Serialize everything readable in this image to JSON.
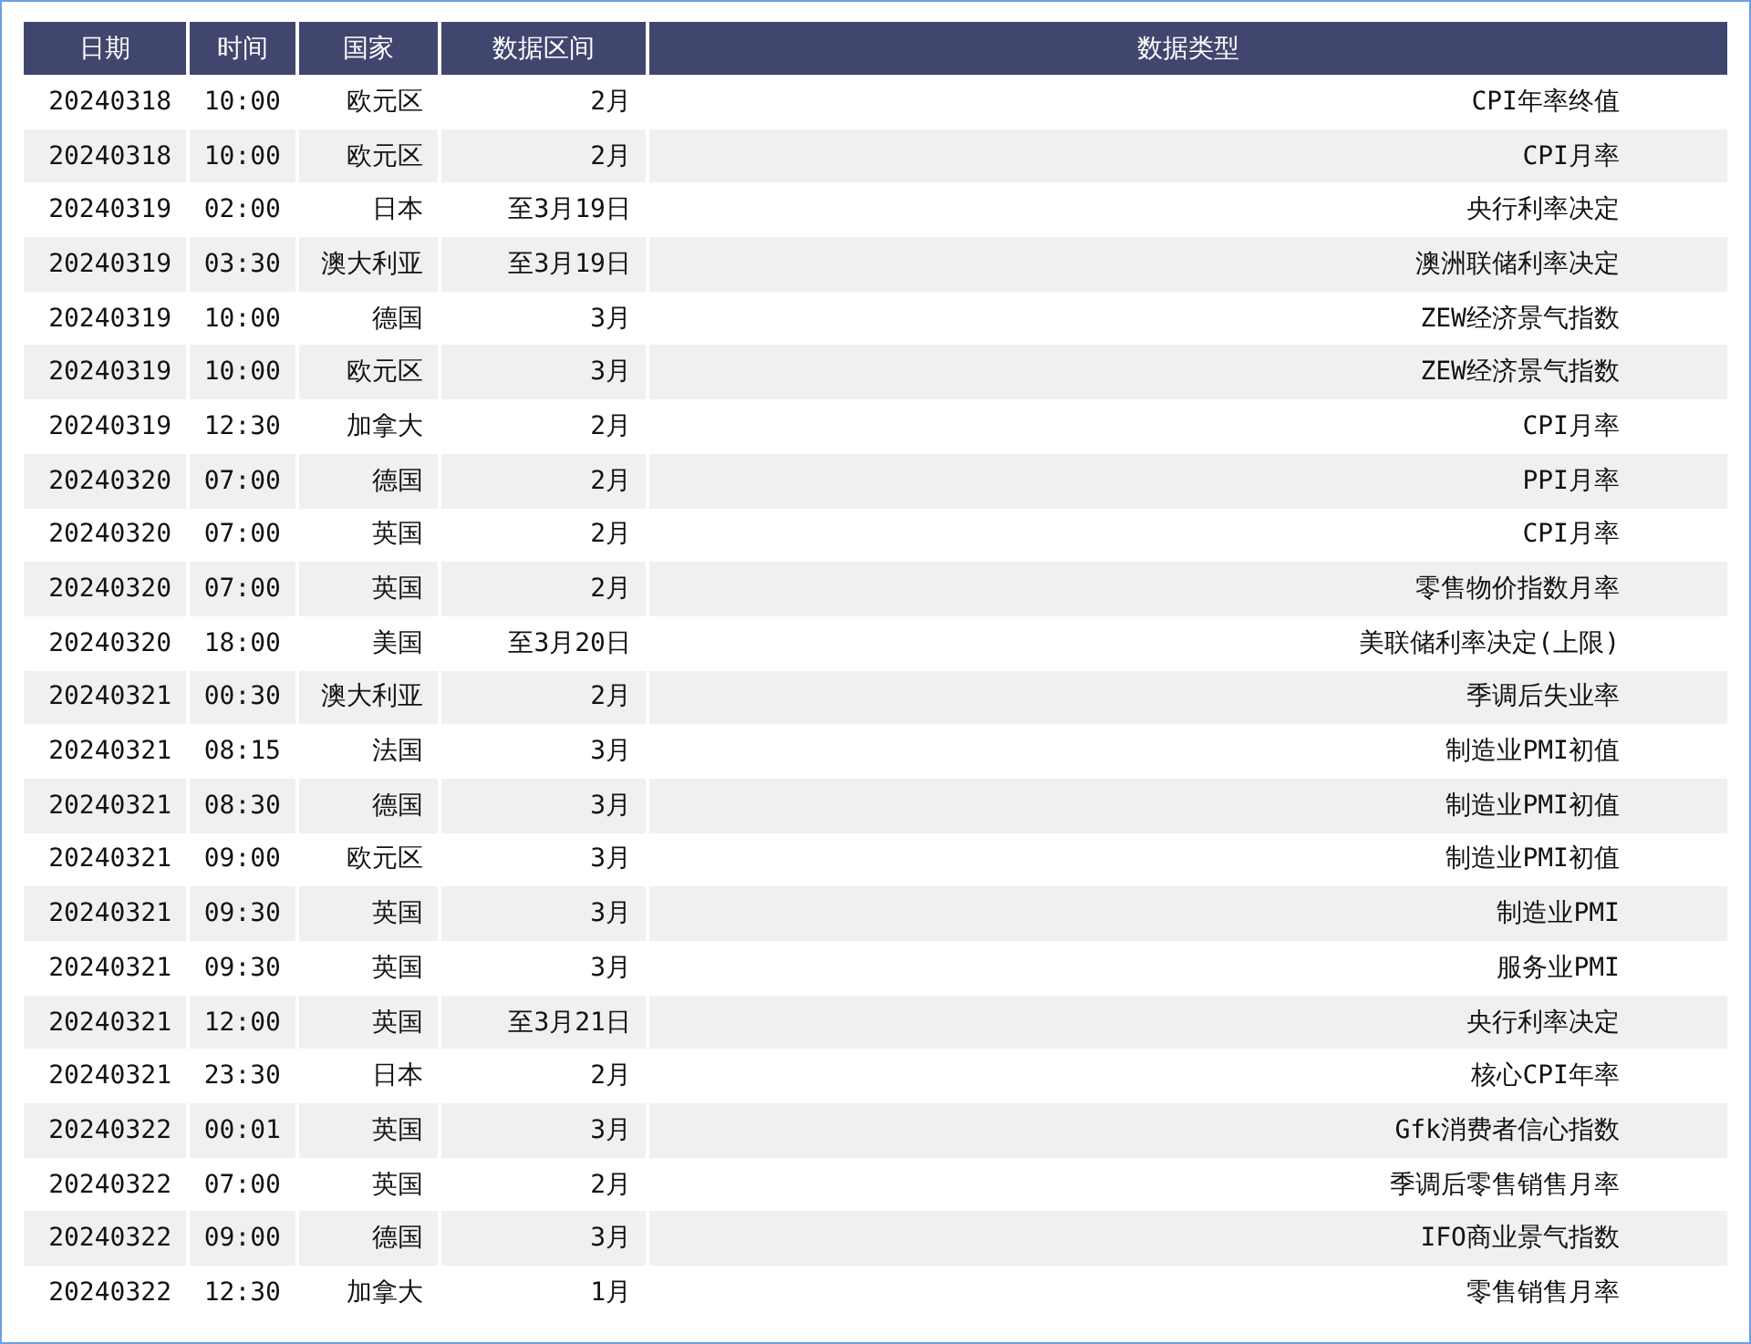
{
  "table": {
    "columns": [
      "日期",
      "时间",
      "国家",
      "数据区间",
      "数据类型"
    ],
    "rows": [
      [
        "20240318",
        "10:00",
        "欧元区",
        "2月",
        "CPI年率终值"
      ],
      [
        "20240318",
        "10:00",
        "欧元区",
        "2月",
        "CPI月率"
      ],
      [
        "20240319",
        "02:00",
        "日本",
        "至3月19日",
        "央行利率决定"
      ],
      [
        "20240319",
        "03:30",
        "澳大利亚",
        "至3月19日",
        "澳洲联储利率决定"
      ],
      [
        "20240319",
        "10:00",
        "德国",
        "3月",
        "ZEW经济景气指数"
      ],
      [
        "20240319",
        "10:00",
        "欧元区",
        "3月",
        "ZEW经济景气指数"
      ],
      [
        "20240319",
        "12:30",
        "加拿大",
        "2月",
        "CPI月率"
      ],
      [
        "20240320",
        "07:00",
        "德国",
        "2月",
        "PPI月率"
      ],
      [
        "20240320",
        "07:00",
        "英国",
        "2月",
        "CPI月率"
      ],
      [
        "20240320",
        "07:00",
        "英国",
        "2月",
        "零售物价指数月率"
      ],
      [
        "20240320",
        "18:00",
        "美国",
        "至3月20日",
        "美联储利率决定(上限)"
      ],
      [
        "20240321",
        "00:30",
        "澳大利亚",
        "2月",
        "季调后失业率"
      ],
      [
        "20240321",
        "08:15",
        "法国",
        "3月",
        "制造业PMI初值"
      ],
      [
        "20240321",
        "08:30",
        "德国",
        "3月",
        "制造业PMI初值"
      ],
      [
        "20240321",
        "09:00",
        "欧元区",
        "3月",
        "制造业PMI初值"
      ],
      [
        "20240321",
        "09:30",
        "英国",
        "3月",
        "制造业PMI"
      ],
      [
        "20240321",
        "09:30",
        "英国",
        "3月",
        "服务业PMI"
      ],
      [
        "20240321",
        "12:00",
        "英国",
        "至3月21日",
        "央行利率决定"
      ],
      [
        "20240321",
        "23:30",
        "日本",
        "2月",
        "核心CPI年率"
      ],
      [
        "20240322",
        "00:01",
        "英国",
        "3月",
        "Gfk消费者信心指数"
      ],
      [
        "20240322",
        "07:00",
        "英国",
        "2月",
        "季调后零售销售月率"
      ],
      [
        "20240322",
        "09:00",
        "德国",
        "3月",
        "IFO商业景气指数"
      ],
      [
        "20240322",
        "12:30",
        "加拿大",
        "1月",
        "零售销售月率"
      ]
    ]
  }
}
